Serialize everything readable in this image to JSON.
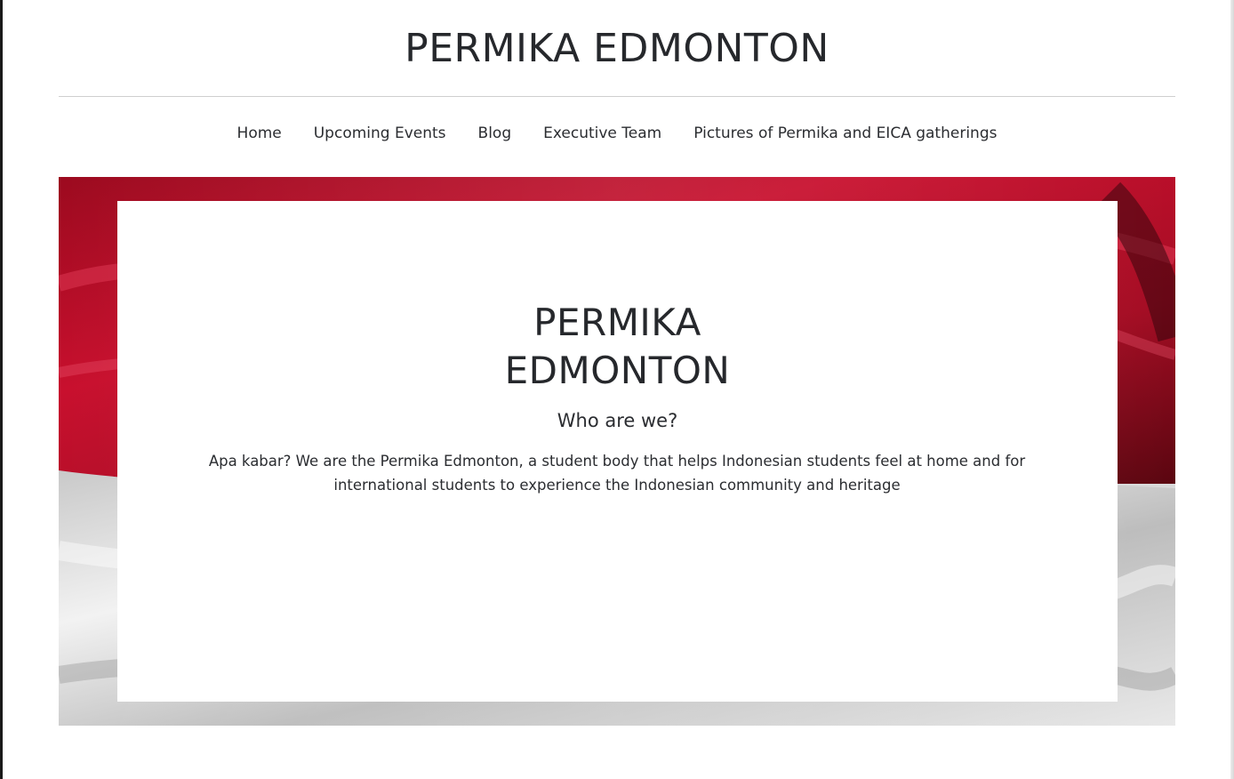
{
  "site": {
    "title": "PERMIKA EDMONTON"
  },
  "nav": {
    "items": [
      {
        "label": "Home"
      },
      {
        "label": "Upcoming Events"
      },
      {
        "label": "Blog"
      },
      {
        "label": "Executive Team"
      },
      {
        "label": "Pictures of Permika and EICA gatherings"
      }
    ]
  },
  "hero": {
    "title_line1": "PERMIKA",
    "title_line2": "EDMONTON",
    "subtitle": "Who are we?",
    "body": "Apa kabar? We are the Permika Edmonton, a student body that helps Indonesian students feel at home and for international students to experience the Indonesian community and heritage",
    "background": "indonesian-flag-image"
  },
  "colors": {
    "flag_red": "#c8102e",
    "flag_white": "#e6e6e6",
    "text": "#2b2d31"
  }
}
